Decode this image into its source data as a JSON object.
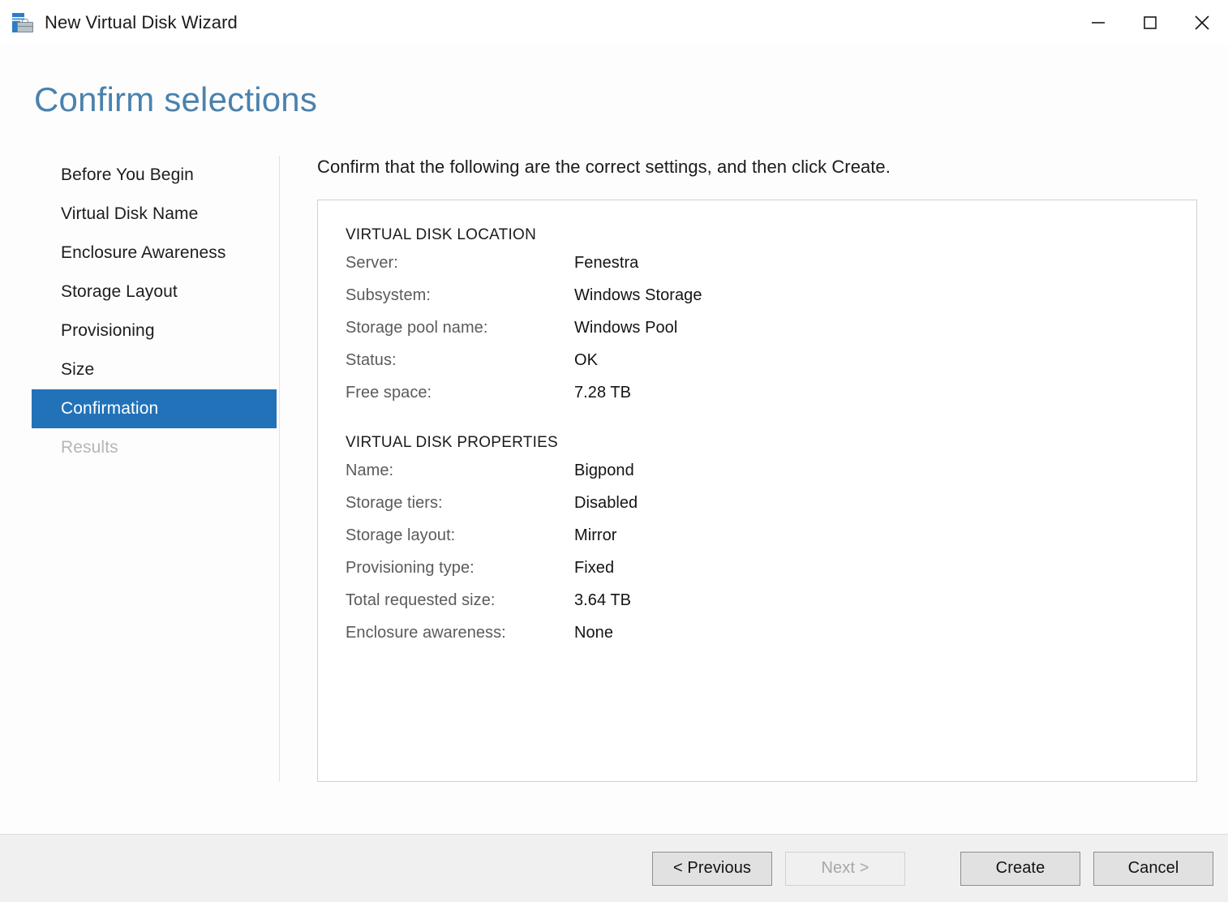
{
  "window": {
    "title": "New Virtual Disk Wizard",
    "icon": "virtual-disk-wizard-icon",
    "controls": {
      "minimize": "minimize-icon",
      "maximize": "maximize-icon",
      "close": "close-icon"
    }
  },
  "page": {
    "title": "Confirm selections",
    "title_color": "#4a82ad",
    "accent_color": "#2272b9"
  },
  "sidebar": {
    "items": [
      {
        "label": "Before You Begin",
        "state": "normal"
      },
      {
        "label": "Virtual Disk Name",
        "state": "normal"
      },
      {
        "label": "Enclosure Awareness",
        "state": "normal"
      },
      {
        "label": "Storage Layout",
        "state": "normal"
      },
      {
        "label": "Provisioning",
        "state": "normal"
      },
      {
        "label": "Size",
        "state": "normal"
      },
      {
        "label": "Confirmation",
        "state": "selected"
      },
      {
        "label": "Results",
        "state": "disabled"
      }
    ]
  },
  "content": {
    "intro": "Confirm that the following are the correct settings, and then click Create.",
    "sections": [
      {
        "title": "VIRTUAL DISK LOCATION",
        "rows": [
          {
            "label": "Server:",
            "value": "Fenestra"
          },
          {
            "label": "Subsystem:",
            "value": "Windows Storage"
          },
          {
            "label": "Storage pool name:",
            "value": "Windows Pool"
          },
          {
            "label": "Status:",
            "value": "OK"
          },
          {
            "label": "Free space:",
            "value": "7.28 TB"
          }
        ]
      },
      {
        "title": "VIRTUAL DISK PROPERTIES",
        "rows": [
          {
            "label": "Name:",
            "value": "Bigpond"
          },
          {
            "label": "Storage tiers:",
            "value": "Disabled"
          },
          {
            "label": "Storage layout:",
            "value": "Mirror"
          },
          {
            "label": "Provisioning type:",
            "value": "Fixed"
          },
          {
            "label": "Total requested size:",
            "value": "3.64 TB"
          },
          {
            "label": "Enclosure awareness:",
            "value": "None"
          }
        ]
      }
    ]
  },
  "footer": {
    "previous_label": "< Previous",
    "next_label": "Next >",
    "next_disabled": true,
    "create_label": "Create",
    "cancel_label": "Cancel"
  }
}
